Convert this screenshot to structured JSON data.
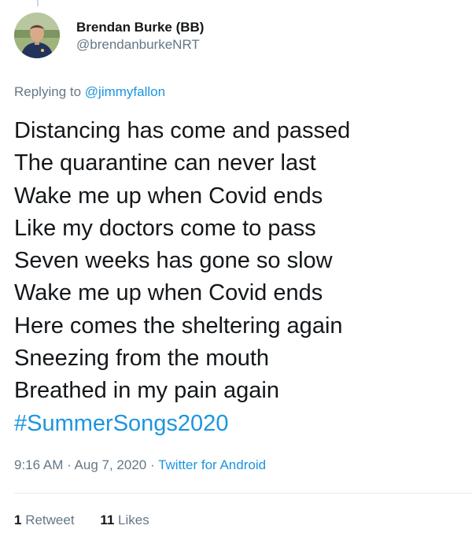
{
  "colors": {
    "text_primary": "#14171a",
    "text_secondary": "#657786",
    "link_blue": "#1b95e0",
    "divider": "#e6ecf0"
  },
  "author": {
    "display_name": "Brendan Burke (BB)",
    "handle": "@brendanburkeNRT",
    "avatar_icon": "profile-photo"
  },
  "reply": {
    "prefix": "Replying to ",
    "to_handle": "@jimmyfallon"
  },
  "tweet": {
    "lines": [
      "Distancing has come and passed",
      "The quarantine can never last",
      "Wake me up when Covid ends",
      "Like my doctors come to pass",
      "Seven weeks has gone so slow",
      "Wake me up when Covid ends",
      "Here comes the sheltering again",
      "Sneezing from the mouth",
      "Breathed in my pain again"
    ],
    "hashtag": "#SummerSongs2020"
  },
  "meta": {
    "time": "9:16 AM",
    "separator": " · ",
    "date": "Aug 7, 2020",
    "source": "Twitter for Android"
  },
  "stats": {
    "retweets_count": "1",
    "retweets_label": "Retweet",
    "likes_count": "11",
    "likes_label": "Likes"
  }
}
